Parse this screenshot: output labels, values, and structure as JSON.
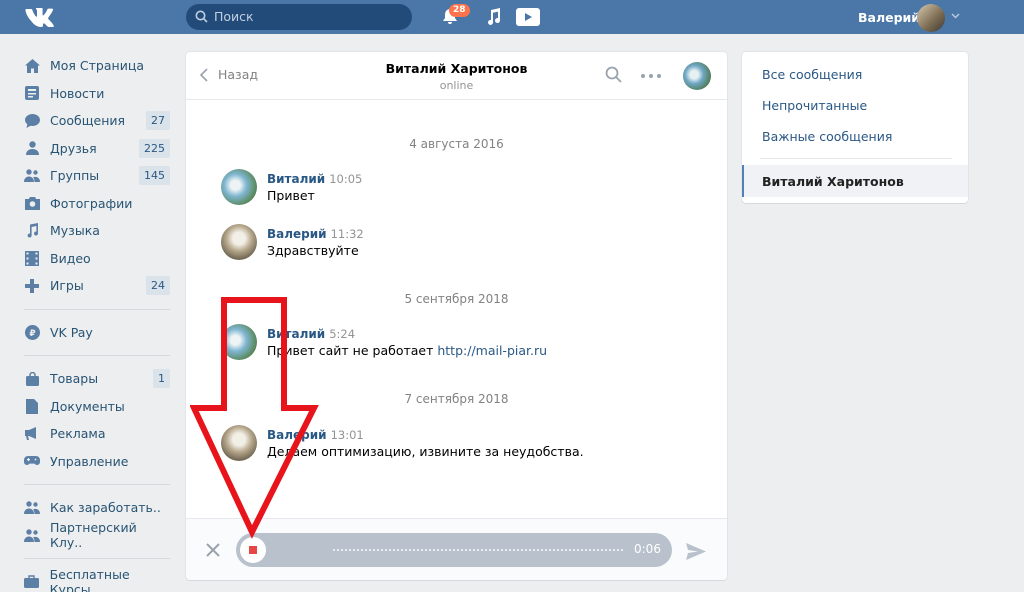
{
  "header": {
    "search_placeholder": "Поиск",
    "notifications_count": "28",
    "user_name": "Валерий"
  },
  "menu": {
    "items": [
      {
        "label": "Моя Страница",
        "icon": "home-icon"
      },
      {
        "label": "Новости",
        "icon": "news-icon"
      },
      {
        "label": "Сообщения",
        "icon": "messages-icon",
        "count": "27"
      },
      {
        "label": "Друзья",
        "icon": "friends-icon",
        "count": "225"
      },
      {
        "label": "Группы",
        "icon": "groups-icon",
        "count": "145"
      },
      {
        "label": "Фотографии",
        "icon": "camera-icon"
      },
      {
        "label": "Музыка",
        "icon": "music-icon"
      },
      {
        "label": "Видео",
        "icon": "video-icon"
      },
      {
        "label": "Игры",
        "icon": "games-icon",
        "count": "24"
      },
      {
        "label": "VK Pay",
        "icon": "vkpay-icon"
      },
      {
        "label": "Товары",
        "icon": "bag-icon",
        "count": "1"
      },
      {
        "label": "Документы",
        "icon": "document-icon"
      },
      {
        "label": "Реклама",
        "icon": "megaphone-icon"
      },
      {
        "label": "Управление",
        "icon": "gamepad-icon"
      },
      {
        "label": "Как заработать..",
        "icon": "people-icon"
      },
      {
        "label": "Партнерский Клу..",
        "icon": "people-icon"
      },
      {
        "label": "Бесплатные Курсы",
        "icon": "briefcase-icon"
      }
    ]
  },
  "chat": {
    "back_label": "Назад",
    "peer_name": "Виталий Харитонов",
    "peer_status": "online",
    "dates": [
      "4 августа 2016",
      "5 сентября 2018",
      "7 сентября 2018"
    ],
    "messages": [
      {
        "author": "Виталий",
        "time": "10:05",
        "text": "Привет"
      },
      {
        "author": "Валерий",
        "time": "11:32",
        "text": "Здравствуйте"
      },
      {
        "author": "Виталий",
        "time": "5:24",
        "text": "Привет сайт не работает ",
        "link": "http://mail-piar.ru"
      },
      {
        "author": "Валерий",
        "time": "13:01",
        "text": "Делаем оптимизацию, извините за неудобства."
      }
    ],
    "recording_time": "0:06"
  },
  "right_panel": {
    "all": "Все сообщения",
    "unread": "Непрочитанные",
    "important": "Важные сообщения",
    "selected": "Виталий Харитонов"
  },
  "colors": {
    "header": "#4a76a8",
    "link": "#2a5885",
    "annotation_arrow": "#e8141c",
    "record_stop": "#e64646"
  }
}
